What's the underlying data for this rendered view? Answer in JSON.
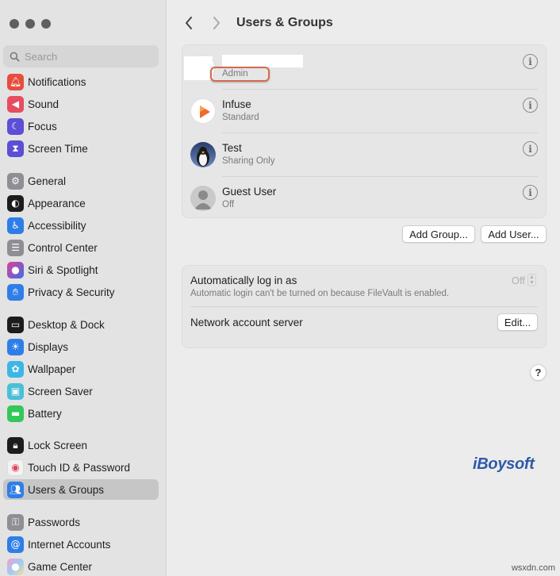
{
  "sidebar": {
    "search_placeholder": "Search",
    "items": [
      {
        "label": "Notifications",
        "icon": "bell-icon",
        "color": "#e84c3d"
      },
      {
        "label": "Sound",
        "icon": "speaker-icon",
        "color": "#e84c5f"
      },
      {
        "label": "Focus",
        "icon": "moon-icon",
        "color": "#5b4fd6"
      },
      {
        "label": "Screen Time",
        "icon": "hourglass-icon",
        "color": "#5b4fd6"
      },
      {
        "label": "General",
        "icon": "gear-icon",
        "color": "#8e8e93"
      },
      {
        "label": "Appearance",
        "icon": "appearance-icon",
        "color": "#1c1c1e"
      },
      {
        "label": "Accessibility",
        "icon": "accessibility-icon",
        "color": "#2f7ee8"
      },
      {
        "label": "Control Center",
        "icon": "control-center-icon",
        "color": "#8e8e93"
      },
      {
        "label": "Siri & Spotlight",
        "icon": "siri-icon",
        "color": "#7b3fd1"
      },
      {
        "label": "Privacy & Security",
        "icon": "hand-icon",
        "color": "#2f7ee8"
      },
      {
        "label": "Desktop & Dock",
        "icon": "dock-icon",
        "color": "#1c1c1e"
      },
      {
        "label": "Displays",
        "icon": "sun-icon",
        "color": "#2f7ee8"
      },
      {
        "label": "Wallpaper",
        "icon": "flower-icon",
        "color": "#3db6e6"
      },
      {
        "label": "Screen Saver",
        "icon": "screensaver-icon",
        "color": "#4bbfd8"
      },
      {
        "label": "Battery",
        "icon": "battery-icon",
        "color": "#34c759"
      },
      {
        "label": "Lock Screen",
        "icon": "lock-icon",
        "color": "#1c1c1e"
      },
      {
        "label": "Touch ID & Password",
        "icon": "fingerprint-icon",
        "color": "#f2f2f2"
      },
      {
        "label": "Users & Groups",
        "icon": "users-icon",
        "color": "#2f7ee8"
      },
      {
        "label": "Passwords",
        "icon": "key-icon",
        "color": "#8e8e93"
      },
      {
        "label": "Internet Accounts",
        "icon": "at-icon",
        "color": "#2f7ee8"
      },
      {
        "label": "Game Center",
        "icon": "game-center-icon",
        "color": "#f4a0c8"
      }
    ]
  },
  "main": {
    "title": "Users & Groups",
    "users": [
      {
        "name": "",
        "role": "Admin"
      },
      {
        "name": "Infuse",
        "role": "Standard"
      },
      {
        "name": "Test",
        "role": "Sharing Only"
      },
      {
        "name": "Guest User",
        "role": "Off"
      }
    ],
    "add_group_label": "Add Group...",
    "add_user_label": "Add User...",
    "auto_login_title": "Automatically log in as",
    "auto_login_subtitle": "Automatic login can't be turned on because FileVault is enabled.",
    "auto_login_value": "Off",
    "network_server_title": "Network account server",
    "edit_label": "Edit...",
    "help_label": "?"
  },
  "watermarks": {
    "brand": "iBoysoft",
    "site": "wsxdn.com"
  },
  "colors": {
    "highlight": "#d46a4f",
    "selected_sidebar": "#c6c6c6"
  }
}
